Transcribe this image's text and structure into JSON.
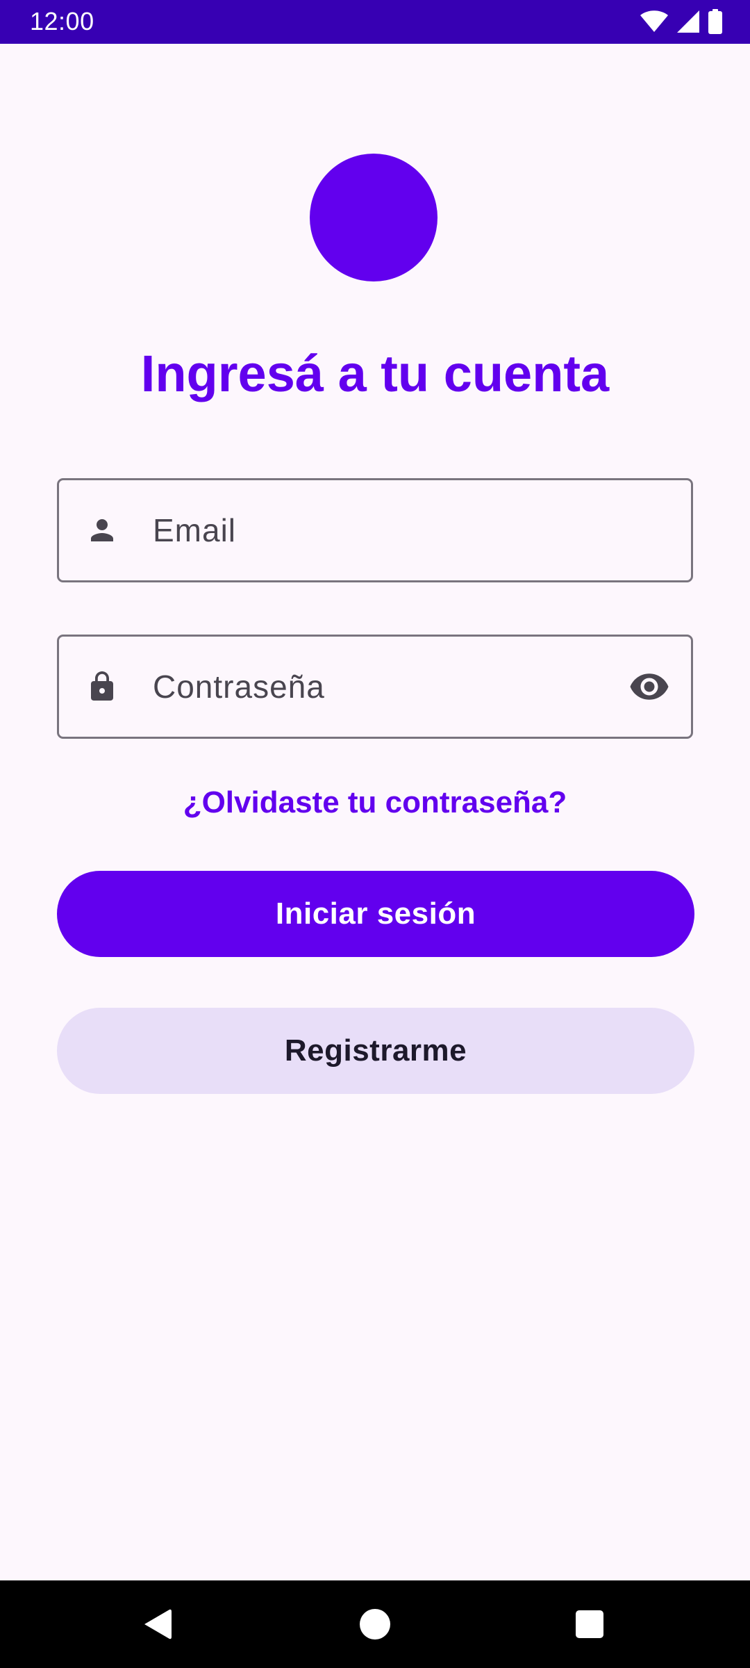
{
  "status_bar": {
    "time": "12:00",
    "icons": [
      "wifi-icon",
      "signal-icon",
      "battery-icon"
    ],
    "background": "#3700B3"
  },
  "logo": {
    "color": "#6200EE"
  },
  "title": "Ingresá a tu cuenta",
  "email_field": {
    "placeholder": "Email",
    "icon": "person-icon"
  },
  "password_field": {
    "placeholder": "Contraseña",
    "icon": "lock-icon",
    "toggle_icon": "eye-icon"
  },
  "forgot_password_link": "¿Olvidaste tu contraseña?",
  "login_button": {
    "label": "Iniciar sesión",
    "color": "#6200EE"
  },
  "register_button": {
    "label": "Registrarme",
    "color": "#E8DEF8"
  },
  "nav_bar": {
    "icons": [
      "back-icon",
      "home-icon",
      "recents-icon"
    ]
  }
}
